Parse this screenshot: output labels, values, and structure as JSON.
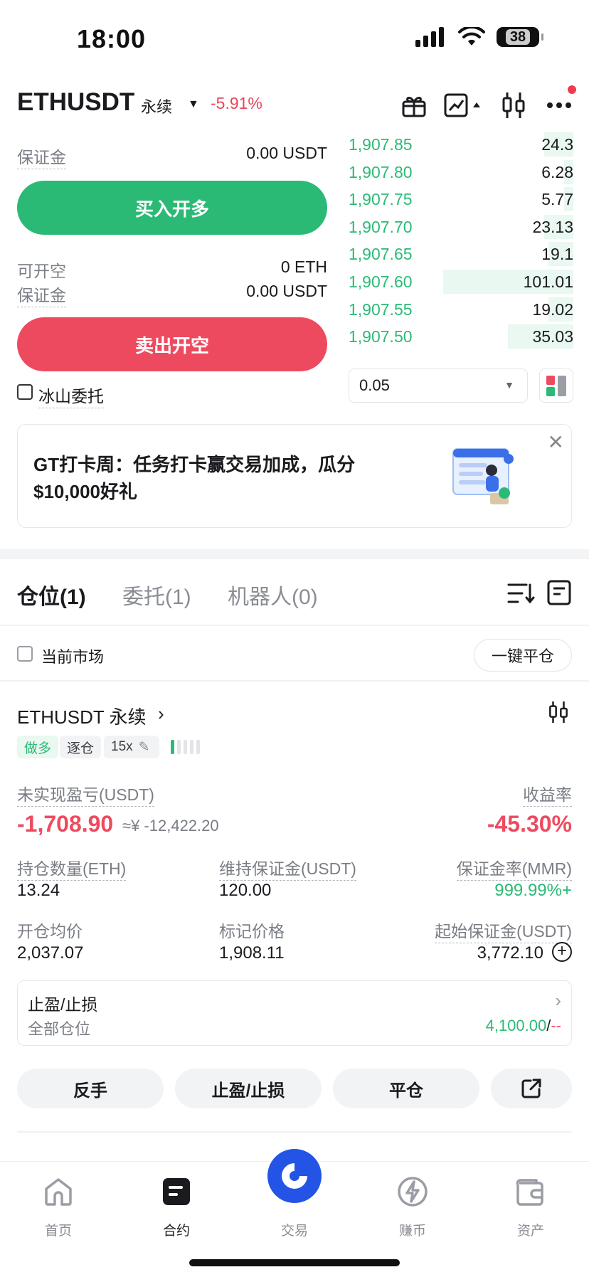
{
  "status_bar": {
    "time": "18:00",
    "battery": "38"
  },
  "header": {
    "pair": "ETHUSDT",
    "contract": "永续",
    "change": "-5.91%"
  },
  "order_form": {
    "margin_label_1": "保证金",
    "margin_value_1": "0.00 USDT",
    "buy_button": "买入开多",
    "open_short_label": "可开空",
    "open_short_value": "0 ETH",
    "margin_label_2": "保证金",
    "margin_value_2": "0.00 USDT",
    "sell_button": "卖出开空",
    "iceberg_label": "冰山委托"
  },
  "order_book": {
    "rows": [
      {
        "price": "1,907.85",
        "qty": "24.3",
        "depth": 0.13
      },
      {
        "price": "1,907.80",
        "qty": "6.28",
        "depth": 0.04
      },
      {
        "price": "1,907.75",
        "qty": "5.77",
        "depth": 0.04
      },
      {
        "price": "1,907.70",
        "qty": "23.13",
        "depth": 0.13
      },
      {
        "price": "1,907.65",
        "qty": "19.1",
        "depth": 0.11
      },
      {
        "price": "1,907.60",
        "qty": "101.01",
        "depth": 0.58
      },
      {
        "price": "1,907.55",
        "qty": "19.02",
        "depth": 0.11
      },
      {
        "price": "1,907.50",
        "qty": "35.03",
        "depth": 0.29
      }
    ],
    "precision": "0.05"
  },
  "banner": {
    "line1": "GT打卡周：任务打卡赢交易加成，瓜分",
    "line2": "$10,000好礼"
  },
  "tabs": [
    {
      "label": "仓位(1)"
    },
    {
      "label": "委托(1)"
    },
    {
      "label": "机器人(0)"
    }
  ],
  "filter": {
    "current_market": "当前市场",
    "close_all": "一键平仓"
  },
  "position": {
    "title": "ETHUSDT 永续",
    "side": "做多",
    "margin_mode": "逐仓",
    "leverage": "15x",
    "unrealized_label": "未实现盈亏(USDT)",
    "roi_label": "收益率",
    "unrealized_value": "-1,708.90",
    "unrealized_cny": "≈¥ -12,422.20",
    "roi_value": "-45.30%",
    "qty_label": "持仓数量(ETH)",
    "qty_value": "13.24",
    "maint_label": "维持保证金(USDT)",
    "maint_value": "120.00",
    "mmr_label": "保证金率(MMR)",
    "mmr_value": "999.99%+",
    "entry_label": "开仓均价",
    "entry_value": "2,037.07",
    "mark_label": "标记价格",
    "mark_value": "1,908.11",
    "init_margin_label": "起始保证金(USDT)",
    "init_margin_value": "3,772.10",
    "tpsl_title": "止盈/止损",
    "tpsl_scope": "全部仓位",
    "tpsl_tp": "4,100.00",
    "tpsl_sep": "/",
    "tpsl_sl": "--"
  },
  "actions": {
    "reverse": "反手",
    "tpsl": "止盈/止损",
    "close": "平仓"
  },
  "nav": [
    {
      "label": "首页",
      "icon": "home-icon"
    },
    {
      "label": "合约",
      "icon": "futures-icon"
    },
    {
      "label": "交易",
      "icon": "trade-icon"
    },
    {
      "label": "赚币",
      "icon": "earn-icon"
    },
    {
      "label": "资产",
      "icon": "wallet-icon"
    }
  ],
  "colors": {
    "green": "#2bba76",
    "red": "#ee4a5f",
    "accent": "#2354e6"
  }
}
